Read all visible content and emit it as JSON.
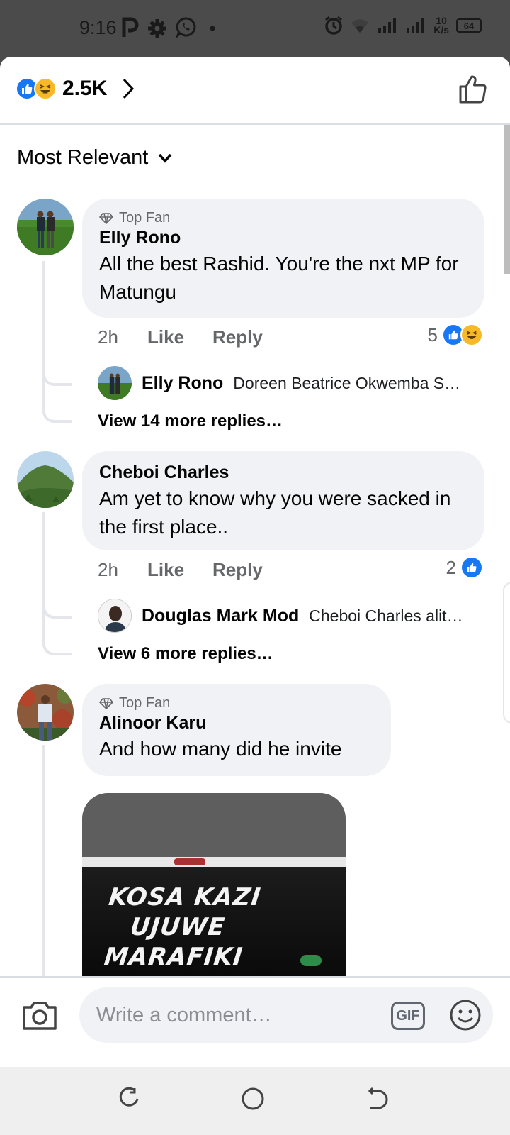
{
  "status_bar": {
    "time": "9:16",
    "speed_value": "10",
    "speed_unit": "K/s",
    "battery": "64",
    "icons": [
      "p-app-icon",
      "gear-icon",
      "whatsapp-icon",
      "dot-icon",
      "alarm-icon",
      "wifi-icon",
      "signal-icon",
      "signal-icon",
      "battery-icon"
    ]
  },
  "header": {
    "reaction_count": "2.5K",
    "reactions": [
      "like",
      "haha"
    ]
  },
  "sort": {
    "label": "Most Relevant"
  },
  "comments": [
    {
      "badge": "Top Fan",
      "author": "Elly Rono",
      "text": "All the best Rashid. You're the nxt MP for Matungu",
      "time": "2h",
      "like_label": "Like",
      "reply_label": "Reply",
      "reaction_count": "5",
      "reply": {
        "author": "Elly Rono",
        "text": "Doreen Beatrice Okwemba S…"
      },
      "more_replies": "View 14 more replies…"
    },
    {
      "author": "Cheboi Charles",
      "text": "Am yet to know why you were sacked in the first place..",
      "time": "2h",
      "like_label": "Like",
      "reply_label": "Reply",
      "reaction_count": "2",
      "reply": {
        "author": "Douglas Mark Mod",
        "text": "Cheboi Charles alit…"
      },
      "more_replies": "View 6 more replies…"
    },
    {
      "badge": "Top Fan",
      "author": "Alinoor Karu",
      "text": "And how many did he invite",
      "image_text": [
        "KOSA KAZI",
        "UJUWE",
        "MARAFIKI"
      ]
    }
  ],
  "composer": {
    "placeholder": "Write a comment…",
    "gif_label": "GIF"
  },
  "colors": {
    "accent": "#1877f2",
    "haha": "#f7b928",
    "bubble": "#f0f2f5",
    "secondary_text": "#65676b"
  }
}
